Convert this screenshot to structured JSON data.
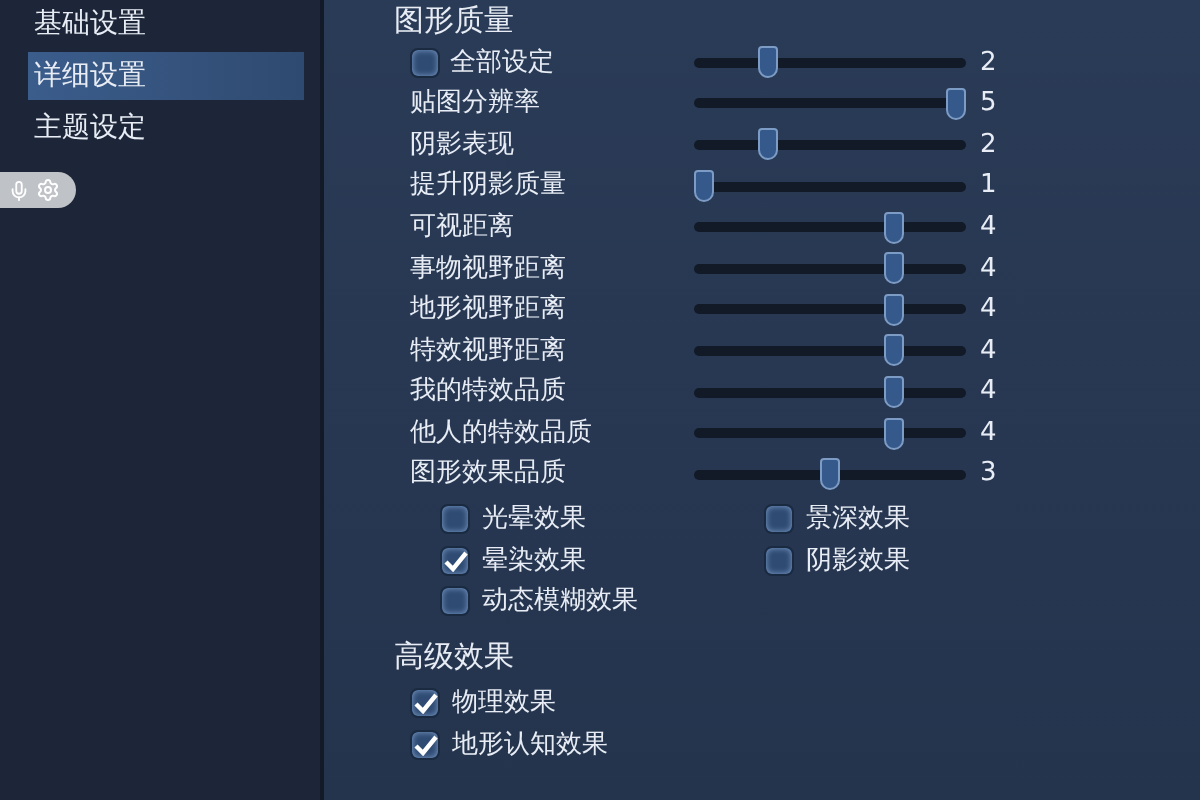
{
  "sidebar": {
    "items": [
      {
        "label": "基础设置",
        "selected": false
      },
      {
        "label": "详细设置",
        "selected": true
      },
      {
        "label": "主题设定",
        "selected": false
      }
    ]
  },
  "graphics": {
    "title": "图形质量",
    "sliders": [
      {
        "label": "全部设定",
        "kind": "checkbox",
        "checked": false,
        "level": 0.25,
        "reading": "2"
      },
      {
        "label": "贴图分辨率",
        "kind": "plain",
        "level": 1,
        "reading": "5"
      },
      {
        "label": "阴影表现",
        "kind": "plain",
        "level": 0.25,
        "reading": "2"
      },
      {
        "label": "提升阴影质量",
        "kind": "plain",
        "level": 0,
        "reading": "1"
      },
      {
        "label": "可视距离",
        "kind": "plain",
        "level": 0.75,
        "reading": "4"
      },
      {
        "label": "事物视野距离",
        "kind": "plain",
        "level": 0.75,
        "reading": "4"
      },
      {
        "label": "地形视野距离",
        "kind": "plain",
        "level": 0.75,
        "reading": "4"
      },
      {
        "label": "特效视野距离",
        "kind": "plain",
        "level": 0.75,
        "reading": "4"
      },
      {
        "label": "我的特效品质",
        "kind": "plain",
        "level": 0.75,
        "reading": "4"
      },
      {
        "label": "他人的特效品质",
        "kind": "plain",
        "level": 0.75,
        "reading": "4"
      },
      {
        "label": "图形效果品质",
        "kind": "plain",
        "level": 0.5,
        "reading": "3"
      }
    ],
    "effects_left": [
      {
        "label": "光晕效果",
        "checked": false
      },
      {
        "label": "晕染效果",
        "checked": true
      },
      {
        "label": "动态模糊效果",
        "checked": false
      }
    ],
    "effects_right": [
      {
        "label": "景深效果",
        "checked": false
      },
      {
        "label": "阴影效果",
        "checked": false
      }
    ]
  },
  "advanced": {
    "title": "高级效果",
    "options": [
      {
        "label": "物理效果",
        "checked": true
      },
      {
        "label": "地形认知效果",
        "checked": true
      }
    ]
  }
}
